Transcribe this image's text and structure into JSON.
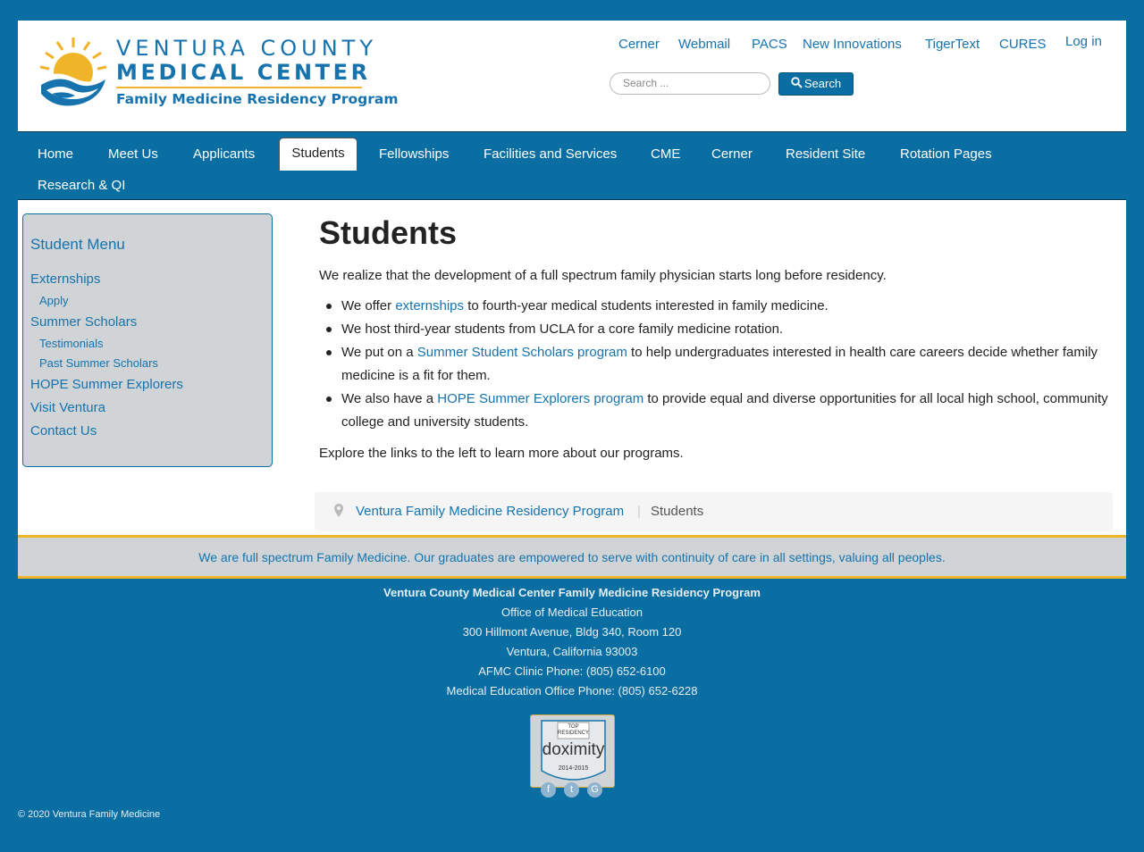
{
  "header": {
    "logo": {
      "line1": "VENTURA COUNTY",
      "line2": "MEDICAL CENTER",
      "line3": "Family Medicine Residency Program"
    },
    "top_links": [
      "Cerner",
      "Webmail",
      "PACS",
      "New Innovations",
      "TigerText",
      "CURES"
    ],
    "login_label": "Log in",
    "search": {
      "placeholder": "Search ...",
      "button_label": "Search"
    }
  },
  "nav": {
    "items": [
      "Home",
      "Meet Us",
      "Applicants",
      "Students",
      "Fellowships",
      "Facilities and Services",
      "CME",
      "Cerner",
      "Resident Site",
      "Rotation Pages",
      "Research & QI"
    ],
    "active": "Students"
  },
  "sidebar": {
    "title": "Student Menu",
    "items": [
      {
        "label": "Externships",
        "level": 1
      },
      {
        "label": "Apply",
        "level": 2
      },
      {
        "label": "Summer Scholars",
        "level": 1
      },
      {
        "label": "Testimonials",
        "level": 2
      },
      {
        "label": "Past Summer Scholars",
        "level": 2
      },
      {
        "label": "HOPE Summer Explorers",
        "level": 1
      },
      {
        "label": "Visit Ventura",
        "level": 1
      },
      {
        "label": "Contact Us",
        "level": 1
      }
    ]
  },
  "content": {
    "title": "Students",
    "intro": "We realize that the development of a full spectrum family physician starts long before residency.",
    "bullets": [
      {
        "pre": "We offer ",
        "link": "externships",
        "post": " to fourth-year medical students interested in family medicine."
      },
      {
        "pre": "We host third-year students from UCLA for a core family medicine rotation.",
        "link": "",
        "post": ""
      },
      {
        "pre": "We put on a ",
        "link": "Summer Student Scholars program",
        "post": " to help undergraduates interested in health care careers decide whether family medicine is a fit for them."
      },
      {
        "pre": "We also have a ",
        "link": "HOPE Summer Explorers program",
        "post": " to provide equal and diverse opportunities for all local high school, community college and university students."
      }
    ],
    "explore": "Explore the links to the left to learn more about our programs."
  },
  "breadcrumb": {
    "home": "Ventura Family Medicine Residency Program",
    "separator": "|",
    "current": "Students"
  },
  "banner": "We are full spectrum Family Medicine. Our graduates are empowered to serve with continuity of care in all settings, valuing all peoples.",
  "footer": {
    "org": "Ventura County Medical Center Family Medicine Residency Program",
    "office": "Office of Medical Education",
    "address1": "300 Hillmont Avenue, Bldg 340, Room 120",
    "address2": "Ventura, California 93003",
    "phone1": "AFMC Clinic Phone: (805) 652-6100",
    "phone2": "Medical Education Office Phone: (805) 652-6228",
    "badge": {
      "line1": "TOP",
      "line2": "RESIDENCY",
      "brand": "doximity",
      "years": "2014-2015"
    },
    "social_icons": [
      "facebook-icon",
      "twitter-icon",
      "google-icon"
    ],
    "copyright": "© 2020 Ventura Family Medicine"
  },
  "colors": {
    "brand_blue": "#0a6ea3",
    "link_blue": "#1673ad",
    "accent_gold": "#f0b429",
    "panel_gray": "#d0d4d6"
  }
}
